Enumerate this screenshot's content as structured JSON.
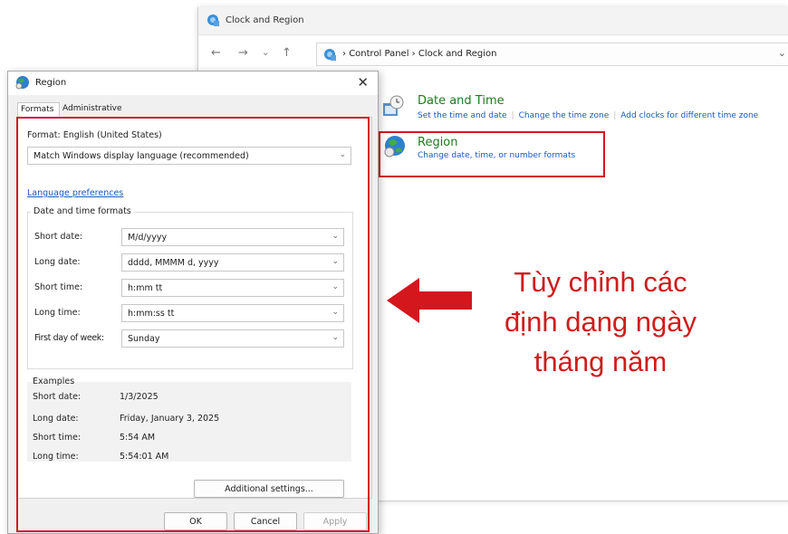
{
  "control_panel": {
    "window_title": "Clock and Region",
    "breadcrumb": [
      "Control Panel",
      "Clock and Region"
    ],
    "sections": [
      {
        "title": "Date and Time",
        "links": [
          "Set the time and date",
          "Change the time zone",
          "Add clocks for different time zone"
        ]
      },
      {
        "title": "Region",
        "links": [
          "Change date, time, or number formats"
        ]
      }
    ]
  },
  "region_dialog": {
    "title": "Region",
    "tabs": [
      "Formats",
      "Administrative"
    ],
    "format_label": "Format: English (United States)",
    "format_value": "Match Windows display language (recommended)",
    "language_link": "Language preferences",
    "date_time_group": "Date and time formats",
    "fields": [
      {
        "label": "Short date:",
        "value": "M/d/yyyy"
      },
      {
        "label": "Long date:",
        "value": "dddd, MMMM d, yyyy"
      },
      {
        "label": "Short time:",
        "value": "h:mm tt"
      },
      {
        "label": "Long time:",
        "value": "h:mm:ss tt"
      },
      {
        "label": "First day of week:",
        "value": "Sunday"
      }
    ],
    "examples_group": "Examples",
    "examples": [
      {
        "label": "Short date:",
        "value": "1/3/2025"
      },
      {
        "label": "Long date:",
        "value": "Friday, January 3, 2025"
      },
      {
        "label": "Short time:",
        "value": "5:54 AM"
      },
      {
        "label": "Long time:",
        "value": "5:54:01 AM"
      }
    ],
    "additional_settings": "Additional settings...",
    "ok": "OK",
    "cancel": "Cancel",
    "apply": "Apply"
  },
  "annotation": {
    "line1": "Tùy chỉnh các",
    "line2": "định dạng ngày",
    "line3": "tháng năm",
    "color": "#d01c1c"
  },
  "colors": {
    "highlight": "#d4161d",
    "link": "#1a59b8",
    "category_title": "#1e7a1e"
  }
}
